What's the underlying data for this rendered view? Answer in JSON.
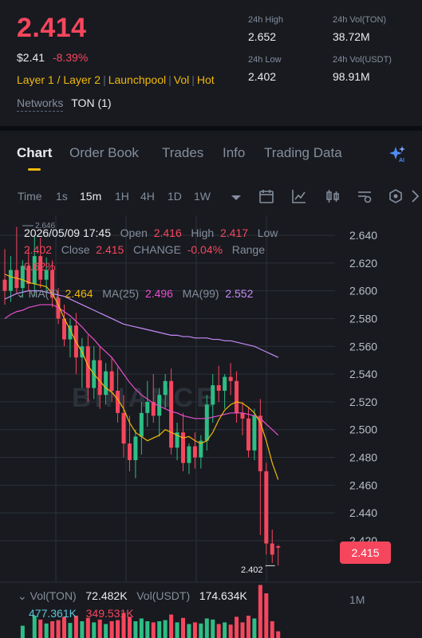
{
  "header": {
    "last_price": "2.414",
    "usd_price": "$2.41",
    "change_pct": "-8.39%",
    "tags": [
      "Layer 1 / Layer 2",
      "Launchpool",
      "Vol",
      "Hot"
    ],
    "networks_label": "Networks",
    "networks_value": "TON (1)",
    "stats": {
      "high_label": "24h High",
      "high_value": "2.652",
      "low_label": "24h Low",
      "low_value": "2.402",
      "vol_base_label": "24h Vol(TON)",
      "vol_base_value": "38.72M",
      "vol_quote_label": "24h Vol(USDT)",
      "vol_quote_value": "98.91M"
    }
  },
  "tabs": [
    "Chart",
    "Order Book",
    "Trades",
    "Info",
    "Trading Data"
  ],
  "intervals": [
    "Time",
    "1s",
    "15m",
    "1H",
    "4H",
    "1D",
    "1W"
  ],
  "active_interval": "15m",
  "candle_info": {
    "datetime": "2026/05/09 17:45",
    "open_label": "Open",
    "open": "2.416",
    "high_label": "High",
    "high": "2.417",
    "low_label": "Low",
    "low": "2.402",
    "close_label": "Close",
    "close": "2.415",
    "change_label": "CHANGE",
    "change": "-0.04%",
    "range_label": "Range",
    "range": "0.62%"
  },
  "ma": {
    "ma7_label": "MA(7)",
    "ma7": "2.464",
    "ma25_label": "MA(25)",
    "ma25": "2.496",
    "ma99_label": "MA(99)",
    "ma99": "2.552"
  },
  "top_label": "2.646",
  "current_price_tag": "2.415",
  "low_marker": "2.402",
  "watermark": "BINANCE",
  "volume": {
    "base_label": "Vol(TON)",
    "base_value": "72.482K",
    "quote_label": "Vol(USDT)",
    "quote_value": "174.634K",
    "ma5": "477.361K",
    "ma10": "349.531K",
    "axis_label": "1M"
  },
  "colors": {
    "up": "#2ebd85",
    "down": "#f6465d",
    "accent": "#f0b90b",
    "ma7": "#f0b90b",
    "ma25": "#e84ecf",
    "ma99": "#c78bf8"
  },
  "chart_data": {
    "type": "candlestick",
    "y_ticks": [
      "2.640",
      "2.620",
      "2.600",
      "2.580",
      "2.560",
      "2.540",
      "2.520",
      "2.500",
      "2.480",
      "2.460",
      "2.440",
      "2.420"
    ],
    "ylim": [
      2.4,
      2.65
    ],
    "candles": [
      {
        "o": 2.608,
        "h": 2.63,
        "l": 2.59,
        "c": 2.6
      },
      {
        "o": 2.6,
        "h": 2.625,
        "l": 2.592,
        "c": 2.615
      },
      {
        "o": 2.615,
        "h": 2.646,
        "l": 2.598,
        "c": 2.602
      },
      {
        "o": 2.602,
        "h": 2.622,
        "l": 2.595,
        "c": 2.618
      },
      {
        "o": 2.618,
        "h": 2.63,
        "l": 2.6,
        "c": 2.605
      },
      {
        "o": 2.605,
        "h": 2.64,
        "l": 2.596,
        "c": 2.625
      },
      {
        "o": 2.625,
        "h": 2.638,
        "l": 2.602,
        "c": 2.608
      },
      {
        "o": 2.608,
        "h": 2.624,
        "l": 2.598,
        "c": 2.615
      },
      {
        "o": 2.615,
        "h": 2.622,
        "l": 2.588,
        "c": 2.595
      },
      {
        "o": 2.595,
        "h": 2.602,
        "l": 2.576,
        "c": 2.58
      },
      {
        "o": 2.58,
        "h": 2.59,
        "l": 2.56,
        "c": 2.565
      },
      {
        "o": 2.565,
        "h": 2.58,
        "l": 2.552,
        "c": 2.575
      },
      {
        "o": 2.575,
        "h": 2.584,
        "l": 2.54,
        "c": 2.552
      },
      {
        "o": 2.552,
        "h": 2.566,
        "l": 2.53,
        "c": 2.56
      },
      {
        "o": 2.56,
        "h": 2.568,
        "l": 2.52,
        "c": 2.53
      },
      {
        "o": 2.53,
        "h": 2.56,
        "l": 2.522,
        "c": 2.55
      },
      {
        "o": 2.55,
        "h": 2.56,
        "l": 2.515,
        "c": 2.525
      },
      {
        "o": 2.525,
        "h": 2.548,
        "l": 2.518,
        "c": 2.542
      },
      {
        "o": 2.542,
        "h": 2.552,
        "l": 2.52,
        "c": 2.528
      },
      {
        "o": 2.528,
        "h": 2.545,
        "l": 2.505,
        "c": 2.512
      },
      {
        "o": 2.512,
        "h": 2.525,
        "l": 2.48,
        "c": 2.49
      },
      {
        "o": 2.49,
        "h": 2.51,
        "l": 2.47,
        "c": 2.478
      },
      {
        "o": 2.478,
        "h": 2.5,
        "l": 2.465,
        "c": 2.495
      },
      {
        "o": 2.495,
        "h": 2.52,
        "l": 2.482,
        "c": 2.512
      },
      {
        "o": 2.512,
        "h": 2.535,
        "l": 2.502,
        "c": 2.52
      },
      {
        "o": 2.52,
        "h": 2.54,
        "l": 2.505,
        "c": 2.51
      },
      {
        "o": 2.51,
        "h": 2.53,
        "l": 2.495,
        "c": 2.525
      },
      {
        "o": 2.525,
        "h": 2.54,
        "l": 2.515,
        "c": 2.535
      },
      {
        "o": 2.535,
        "h": 2.544,
        "l": 2.482,
        "c": 2.487
      },
      {
        "o": 2.487,
        "h": 2.505,
        "l": 2.478,
        "c": 2.498
      },
      {
        "o": 2.498,
        "h": 2.512,
        "l": 2.47,
        "c": 2.476
      },
      {
        "o": 2.476,
        "h": 2.49,
        "l": 2.468,
        "c": 2.488
      },
      {
        "o": 2.488,
        "h": 2.498,
        "l": 2.472,
        "c": 2.48
      },
      {
        "o": 2.48,
        "h": 2.496,
        "l": 2.472,
        "c": 2.492
      },
      {
        "o": 2.492,
        "h": 2.525,
        "l": 2.485,
        "c": 2.518
      },
      {
        "o": 2.518,
        "h": 2.54,
        "l": 2.505,
        "c": 2.532
      },
      {
        "o": 2.532,
        "h": 2.546,
        "l": 2.52,
        "c": 2.528
      },
      {
        "o": 2.528,
        "h": 2.54,
        "l": 2.515,
        "c": 2.538
      },
      {
        "o": 2.538,
        "h": 2.548,
        "l": 2.525,
        "c": 2.535
      },
      {
        "o": 2.535,
        "h": 2.542,
        "l": 2.505,
        "c": 2.512
      },
      {
        "o": 2.512,
        "h": 2.52,
        "l": 2.496,
        "c": 2.508
      },
      {
        "o": 2.508,
        "h": 2.516,
        "l": 2.48,
        "c": 2.485
      },
      {
        "o": 2.485,
        "h": 2.515,
        "l": 2.478,
        "c": 2.51
      },
      {
        "o": 2.51,
        "h": 2.522,
        "l": 2.424,
        "c": 2.47
      },
      {
        "o": 2.47,
        "h": 2.476,
        "l": 2.41,
        "c": 2.418
      },
      {
        "o": 2.418,
        "h": 2.428,
        "l": 2.404,
        "c": 2.41
      },
      {
        "o": 2.416,
        "h": 2.417,
        "l": 2.402,
        "c": 2.415
      }
    ],
    "ma7": [
      2.612,
      2.61,
      2.609,
      2.608,
      2.606,
      2.605,
      2.604,
      2.603,
      2.598,
      2.59,
      2.58,
      2.572,
      2.563,
      2.556,
      2.546,
      2.54,
      2.535,
      2.53,
      2.527,
      2.522,
      2.515,
      2.505,
      2.498,
      2.495,
      2.492,
      2.494,
      2.496,
      2.5,
      2.498,
      2.496,
      2.494,
      2.495,
      2.492,
      2.49,
      2.492,
      2.498,
      2.507,
      2.514,
      2.518,
      2.52,
      2.519,
      2.516,
      2.512,
      2.505,
      2.492,
      2.476,
      2.464
    ],
    "ma25": [
      2.58,
      2.583,
      2.585,
      2.586,
      2.588,
      2.589,
      2.59,
      2.59,
      2.59,
      2.588,
      2.585,
      2.582,
      2.578,
      2.574,
      2.569,
      2.565,
      2.56,
      2.556,
      2.552,
      2.546,
      2.54,
      2.534,
      2.529,
      2.525,
      2.522,
      2.519,
      2.517,
      2.515,
      2.513,
      2.512,
      2.51,
      2.509,
      2.508,
      2.508,
      2.508,
      2.509,
      2.51,
      2.511,
      2.512,
      2.512,
      2.512,
      2.511,
      2.51,
      2.508,
      2.504,
      2.5,
      2.496
    ],
    "ma99": [
      2.594,
      2.596,
      2.598,
      2.599,
      2.6,
      2.6,
      2.6,
      2.599,
      2.598,
      2.597,
      2.596,
      2.594,
      2.592,
      2.59,
      2.588,
      2.586,
      2.584,
      2.582,
      2.58,
      2.578,
      2.576,
      2.575,
      2.574,
      2.573,
      2.572,
      2.571,
      2.57,
      2.569,
      2.568,
      2.568,
      2.567,
      2.567,
      2.566,
      2.566,
      2.566,
      2.565,
      2.565,
      2.564,
      2.564,
      2.563,
      2.562,
      2.561,
      2.56,
      2.558,
      2.556,
      2.554,
      2.552
    ],
    "volume": [
      0.28,
      0.25,
      0.35,
      0.22,
      0.3,
      0.4,
      0.33,
      0.26,
      0.3,
      0.32,
      0.38,
      0.27,
      0.4,
      0.3,
      0.36,
      0.28,
      0.33,
      0.25,
      0.3,
      0.32,
      0.45,
      0.38,
      0.3,
      0.35,
      0.3,
      0.28,
      0.3,
      0.32,
      0.42,
      0.28,
      0.36,
      0.25,
      0.28,
      0.26,
      0.35,
      0.33,
      0.25,
      0.28,
      0.24,
      0.38,
      0.28,
      0.4,
      0.35,
      0.95,
      0.8,
      0.3,
      0.12
    ]
  }
}
